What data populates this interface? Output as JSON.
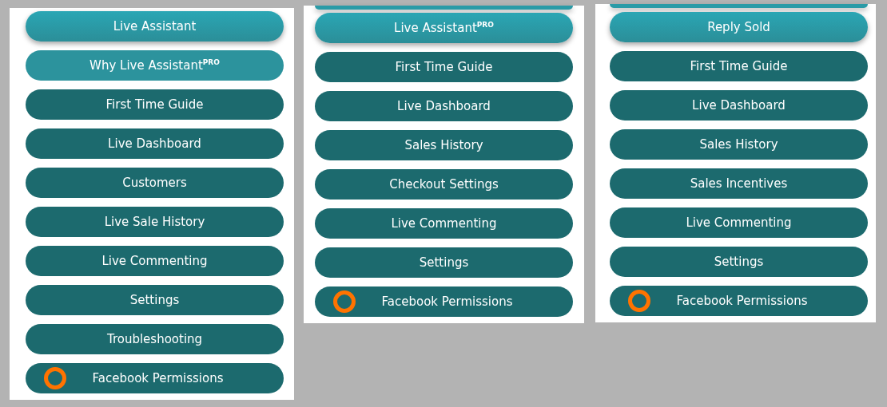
{
  "panels": [
    {
      "partial_button_above": false,
      "buttons": [
        {
          "label": "Live Assistant",
          "kind": "accent"
        },
        {
          "label": "Why Live Assistant$^{PRO}$",
          "kind": "light"
        },
        {
          "label": "First Time Guide",
          "kind": "dark"
        },
        {
          "label": "Live Dashboard",
          "kind": "dark"
        },
        {
          "label": "Customers",
          "kind": "dark"
        },
        {
          "label": "Live Sale History",
          "kind": "dark"
        },
        {
          "label": "Live Commenting",
          "kind": "dark"
        },
        {
          "label": "Settings",
          "kind": "dark"
        },
        {
          "label": "Troubleshooting",
          "kind": "dark"
        },
        {
          "label": "Facebook Permissions",
          "kind": "status"
        }
      ]
    },
    {
      "partial_button_above": true,
      "buttons": [
        {
          "label": "Live Assistant$^{PRO}$",
          "kind": "accent"
        },
        {
          "label": "First Time Guide",
          "kind": "dark"
        },
        {
          "label": "Live Dashboard",
          "kind": "dark"
        },
        {
          "label": "Sales History",
          "kind": "dark"
        },
        {
          "label": "Checkout Settings",
          "kind": "dark"
        },
        {
          "label": "Live Commenting",
          "kind": "dark"
        },
        {
          "label": "Settings",
          "kind": "dark"
        },
        {
          "label": "Facebook Permissions",
          "kind": "status"
        }
      ]
    },
    {
      "partial_button_above": true,
      "buttons": [
        {
          "label": "Reply Sold",
          "kind": "accent"
        },
        {
          "label": "First Time Guide",
          "kind": "dark"
        },
        {
          "label": "Live Dashboard",
          "kind": "dark"
        },
        {
          "label": "Sales History",
          "kind": "dark"
        },
        {
          "label": "Sales Incentives",
          "kind": "dark"
        },
        {
          "label": "Live Commenting",
          "kind": "dark"
        },
        {
          "label": "Settings",
          "kind": "dark"
        },
        {
          "label": "Facebook Permissions",
          "kind": "status"
        }
      ]
    }
  ]
}
